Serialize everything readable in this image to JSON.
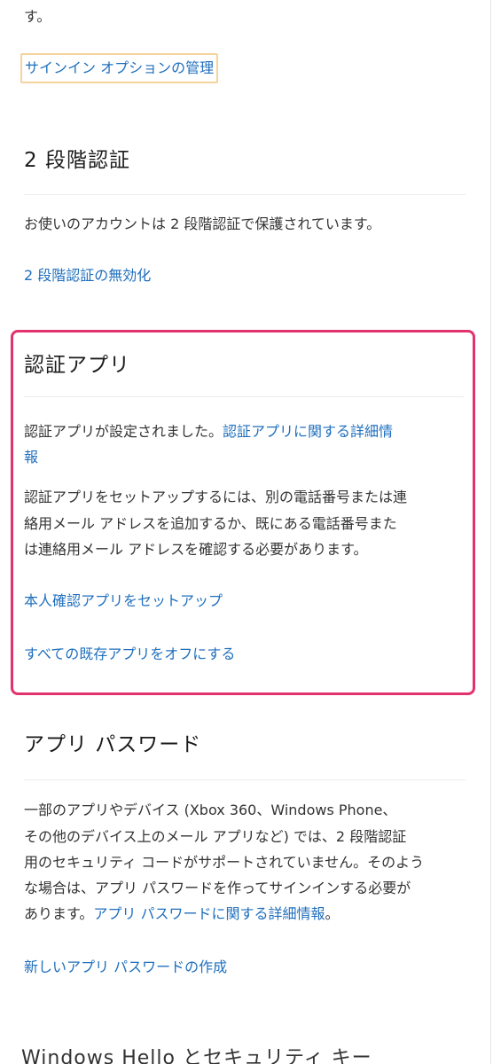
{
  "top_fragment": "す。",
  "signin_options_link": "サインイン オプションの管理",
  "two_step": {
    "heading": "2 段階認証",
    "description": "お使いのアカウントは 2 段階認証で保護されています。",
    "disable_link": "2 段階認証の無効化"
  },
  "auth_app": {
    "heading": "認証アプリ",
    "status_text": "認証アプリが設定されました。",
    "details_link_line1": "認証アプリに関する詳細情",
    "details_link_line2": "報",
    "setup_line1": "認証アプリをセットアップするには、別の電話番号または連",
    "setup_line2": "絡用メール アドレスを追加するか、既にある電話番号また",
    "setup_line3": "は連絡用メール アドレスを確認する必要があります。",
    "setup_identity_link": "本人確認アプリをセットアップ",
    "turn_off_link": "すべての既存アプリをオフにする"
  },
  "app_password": {
    "heading": "アプリ パスワード",
    "desc_line1": "一部のアプリやデバイス (Xbox 360、Windows Phone、",
    "desc_line2": "その他のデバイス上のメール アプリなど) では、2 段階認証",
    "desc_line3": "用のセキュリティ コードがサポートされていません。そのよう",
    "desc_line4": "な場合は、アプリ パスワードを作ってサインインする必要が",
    "desc_line5_prefix": "あります。",
    "details_link": "アプリ パスワードに関する詳細情報",
    "desc_line5_suffix": "。",
    "create_link": "新しいアプリ パスワードの作成"
  },
  "next_section_heading": "Windows Hello とセキュリティ キー",
  "colors": {
    "link": "#1f6fbd",
    "highlight_border": "#e2336f",
    "focus_border": "#f4d39c",
    "text": "#333333"
  }
}
